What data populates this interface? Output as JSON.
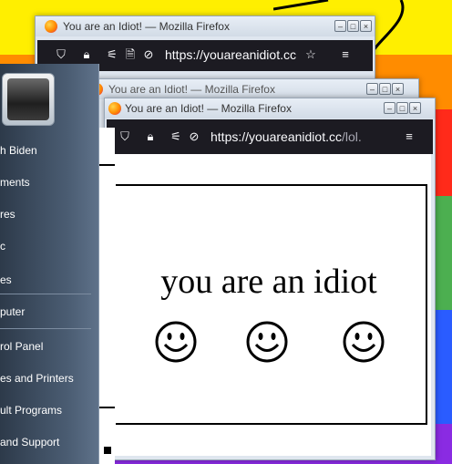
{
  "wallpaper": {
    "colors": [
      "#ffef00",
      "#ff8c00",
      "#ff2a1a",
      "#4caf50",
      "#2a5cff",
      "#8a2be2"
    ]
  },
  "windows": [
    {
      "title": "You are an Idiot! — Mozilla Firefox",
      "url_host": "https://youareanidiot.cc",
      "url_path": ""
    },
    {
      "title": "You are an Idiot! — Mozilla Firefox"
    },
    {
      "title": "You are an Idiot! — Mozilla Firefox",
      "url_host": "https://youareanidiot.cc",
      "url_path": "/lol."
    }
  ],
  "window_controls": {
    "minimize_icon": "minimize-icon",
    "maximize_icon": "maximize-icon",
    "close_icon": "close-icon"
  },
  "page": {
    "message": "you are an idiot",
    "smileys": [
      "smiley-face-icon",
      "smiley-face-icon",
      "smiley-face-icon"
    ]
  },
  "start_menu": {
    "items": [
      "h Biden",
      "ments",
      "res",
      "c",
      "es",
      "puter",
      "rol Panel",
      "es and Printers",
      "ult Programs",
      "and Support"
    ]
  }
}
